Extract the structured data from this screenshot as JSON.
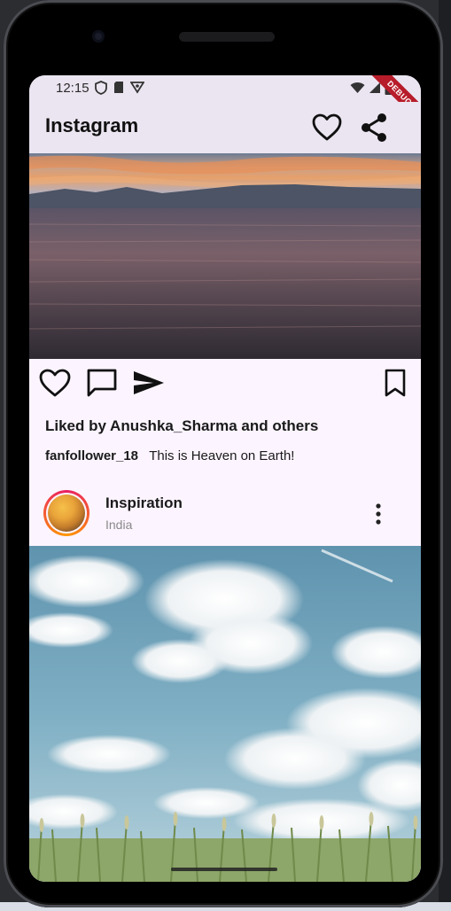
{
  "status_bar": {
    "time": "12:15",
    "left_icons": [
      "shield-icon",
      "sim-card-icon",
      "vpn-icon"
    ],
    "right_icons": [
      "wifi-icon",
      "signal-icon",
      "battery-icon"
    ],
    "debug_label": "DEBUG"
  },
  "app_bar": {
    "title": "Instagram",
    "actions": [
      "heart-icon",
      "share-icon"
    ]
  },
  "post1": {
    "image": "sunset-over-lake",
    "actions": [
      "like-heart-icon",
      "comment-icon",
      "send-icon",
      "bookmark-icon"
    ],
    "liked_by": "Liked by Anushka_Sharma and others",
    "caption_user": "fanfollower_18",
    "caption_text": "This is Heaven on Earth!"
  },
  "post2": {
    "name": "Inspiration",
    "location": "India",
    "image": "clouds-and-grass",
    "more_icon": "more-vert-icon"
  },
  "colors": {
    "app_bar_bg": "#ebe5f1",
    "page_bg": "#fcf4ff",
    "avatar_ring": "#e91e63",
    "debug_ribbon": "#b71c2a"
  }
}
